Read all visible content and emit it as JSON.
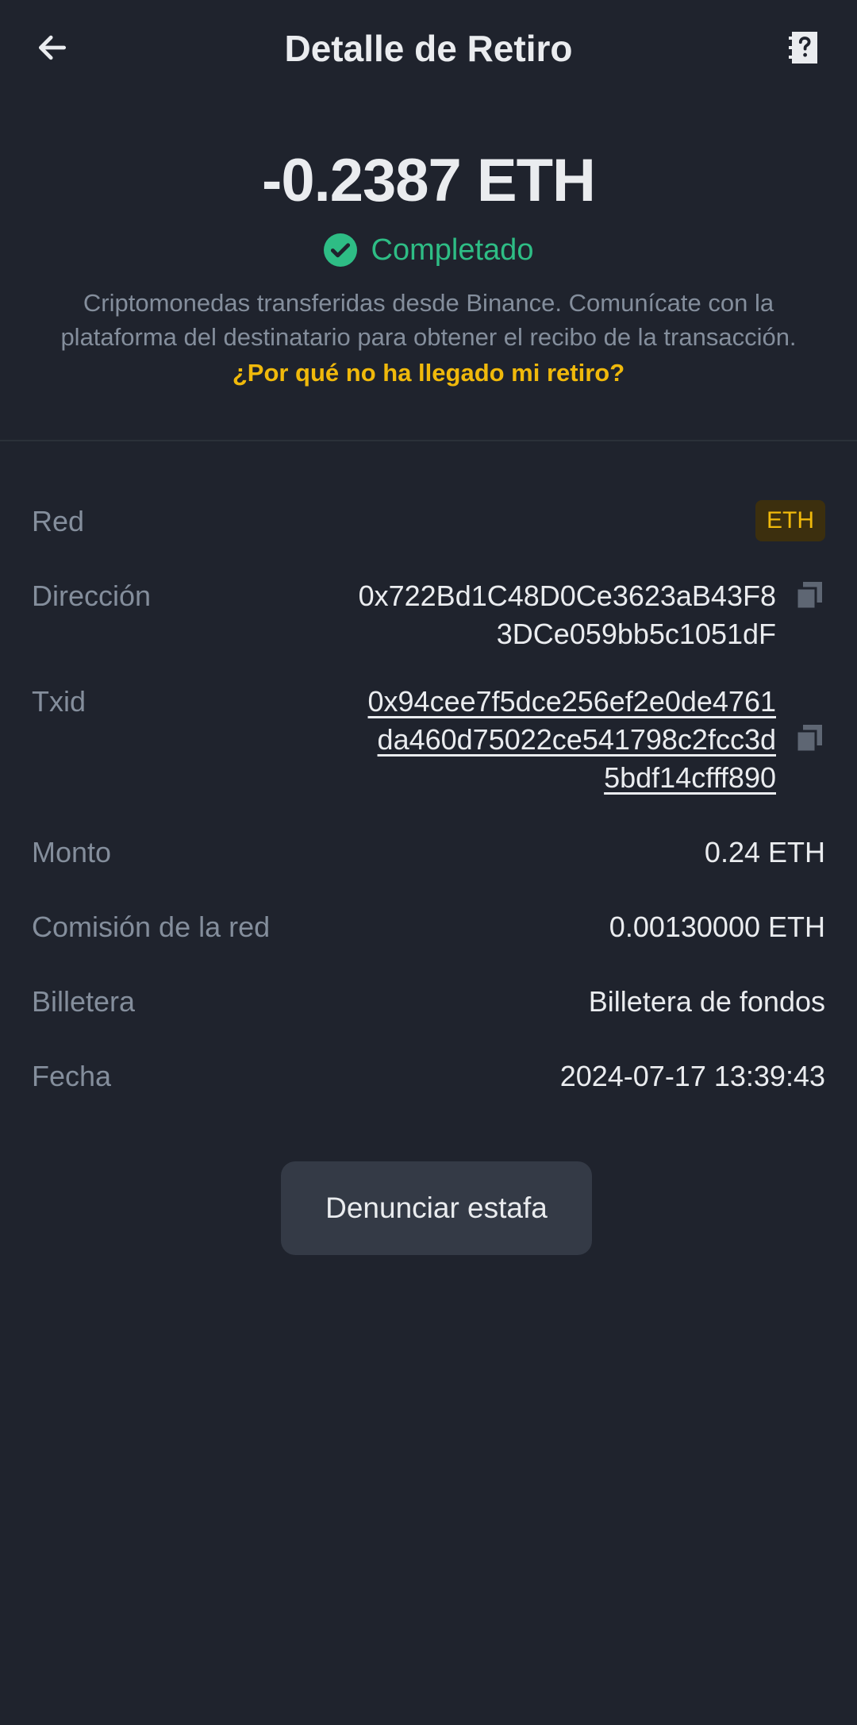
{
  "header": {
    "title": "Detalle de Retiro",
    "back_icon": "arrow-left-icon",
    "help_icon": "help-document-icon"
  },
  "summary": {
    "amount": "-0.2387 ETH",
    "status": "Completado",
    "status_color": "#2ebd85",
    "description": "Criptomonedas transferidas desde Binance. Comunícate con la plataforma del destinatario para obtener el recibo de la transacción.",
    "faq_link": "¿Por qué no ha llegado mi retiro?",
    "accent_color": "#f0b90b"
  },
  "details": {
    "network": {
      "label": "Red",
      "value": "ETH"
    },
    "address": {
      "label": "Dirección",
      "lines": [
        "0x722Bd1C48D0Ce3623aB43F8",
        "3DCe059bb5c1051dF"
      ]
    },
    "txid": {
      "label": "Txid",
      "lines": [
        "0x94cee7f5dce256ef2e0de4761",
        "da460d75022ce541798c2fcc3d",
        "5bdf14cfff890"
      ]
    },
    "amount": {
      "label": "Monto",
      "value": "0.24 ETH"
    },
    "fee": {
      "label": "Comisión de la red",
      "value": "0.00130000 ETH"
    },
    "wallet": {
      "label": "Billetera",
      "value": "Billetera de fondos"
    },
    "date": {
      "label": "Fecha",
      "value": "2024-07-17 13:39:43"
    }
  },
  "actions": {
    "report_label": "Denunciar estafa"
  }
}
